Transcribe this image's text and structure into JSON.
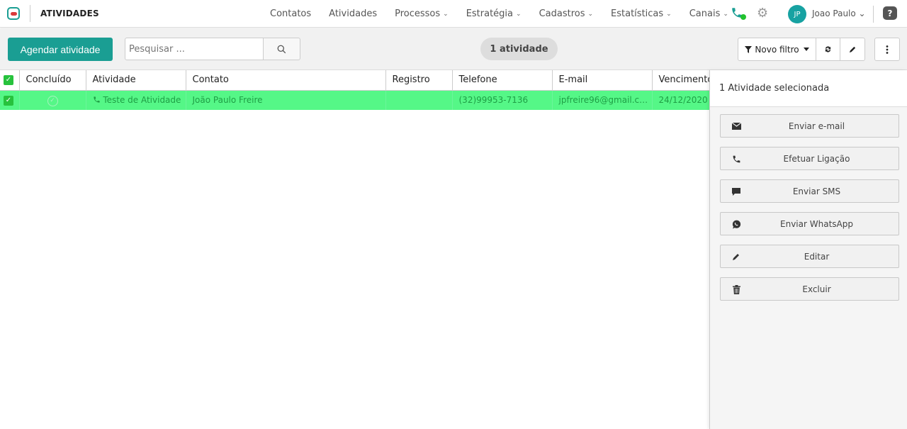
{
  "header": {
    "app_title": "ATIVIDADES",
    "nav": [
      {
        "label": "Contatos",
        "has_caret": false
      },
      {
        "label": "Atividades",
        "has_caret": false
      },
      {
        "label": "Processos",
        "has_caret": true
      },
      {
        "label": "Estratégia",
        "has_caret": true
      },
      {
        "label": "Cadastros",
        "has_caret": true
      },
      {
        "label": "Estatísticas",
        "has_caret": true
      },
      {
        "label": "Canais",
        "has_caret": true
      }
    ],
    "caret": "⌄",
    "avatar_initials": "JP",
    "user_name": "Joao Paulo ⌄",
    "help": "?",
    "status_color": "#22c22e"
  },
  "toolbar": {
    "schedule_button": "Agendar atividade",
    "search_placeholder": "Pesquisar ...",
    "count_label": "1 atividade",
    "filter_label": "Novo filtro"
  },
  "table": {
    "columns": [
      "Concluído",
      "Atividade",
      "Contato",
      "Registro",
      "Telefone",
      "E-mail",
      "Vencimento"
    ],
    "rows": [
      {
        "selected": true,
        "activity": "Teste de Atividade",
        "contact": "João Paulo Freire",
        "record": "",
        "phone": "(32)99953-7136",
        "email": "jpfreire96@gmail.com",
        "due": "24/12/2020"
      }
    ]
  },
  "panel": {
    "title": "1 Atividade selecionada",
    "actions": [
      {
        "label": "Enviar e-mail",
        "icon": "envelope-icon"
      },
      {
        "label": "Efetuar Ligação",
        "icon": "phone-icon"
      },
      {
        "label": "Enviar SMS",
        "icon": "chat-icon"
      },
      {
        "label": "Enviar WhatsApp",
        "icon": "whatsapp-icon"
      },
      {
        "label": "Editar",
        "icon": "pencil-icon"
      },
      {
        "label": "Excluir",
        "icon": "trash-icon"
      }
    ]
  },
  "colors": {
    "brand": "#1a9e93",
    "row_selected": "#55f787",
    "row_text": "#1f9e45"
  }
}
